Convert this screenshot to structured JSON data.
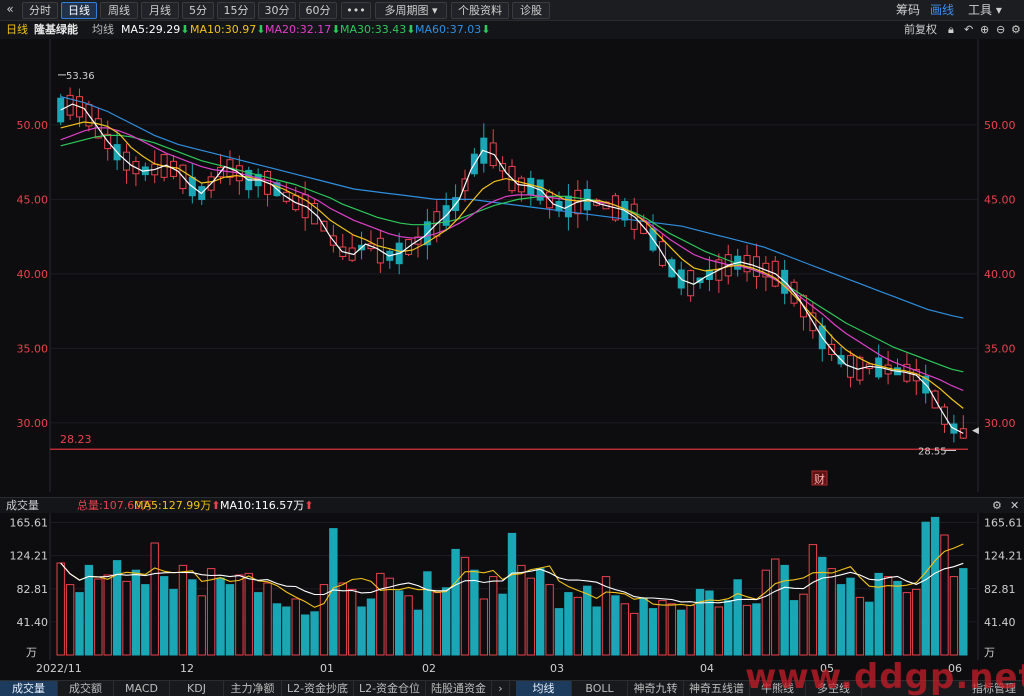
{
  "toolbar": {
    "collapse_icon": "double-chevron-left-icon",
    "left_items": [
      {
        "label": "分时",
        "active": false
      },
      {
        "label": "日线",
        "active": true
      },
      {
        "label": "周线",
        "active": false
      },
      {
        "label": "月线",
        "active": false
      },
      {
        "label": "5分",
        "active": false
      },
      {
        "label": "15分",
        "active": false
      },
      {
        "label": "30分",
        "active": false
      },
      {
        "label": "60分",
        "active": false
      },
      {
        "label": "•••",
        "active": false
      },
      {
        "label": "多周期图 ▾",
        "active": false
      },
      {
        "label": "个股资料",
        "active": false
      },
      {
        "label": "诊股",
        "active": false
      }
    ],
    "right_items": [
      {
        "label": "筹码",
        "active": false
      },
      {
        "label": "画线",
        "active": true
      },
      {
        "label": "工具 ▾",
        "active": false
      }
    ]
  },
  "info": {
    "period": "日线",
    "stock_name": "隆基绿能",
    "avg_label": "均线",
    "ma5": "MA5:29.29",
    "ma10": "MA10:30.97",
    "ma20": "MA20:32.17",
    "ma30": "MA30:33.43",
    "ma60": "MA60:37.03",
    "adjust": "前复权",
    "colors": {
      "ma5": "#ffffff",
      "ma10": "#f2c318",
      "ma20": "#e040c8",
      "ma30": "#2ec95a",
      "ma60": "#2f8fe0",
      "up": "#e8424d",
      "down": "#1aa6b5"
    }
  },
  "volume_header": {
    "title": "成交量",
    "total": "总量:107.60万",
    "ma5": "MA5:127.99万",
    "ma10": "MA10:116.57万"
  },
  "bottom_tabs": [
    {
      "label": "成交量",
      "active": true
    },
    {
      "label": "成交额",
      "active": false
    },
    {
      "label": "MACD",
      "active": false
    },
    {
      "label": "KDJ",
      "active": false
    },
    {
      "label": "主力净额",
      "active": false
    },
    {
      "label": "L2-资金抄底",
      "active": false
    },
    {
      "label": "L2-资金仓位",
      "active": false
    },
    {
      "label": "陆股通资金",
      "active": false
    },
    {
      "label": "›",
      "active": false
    },
    {
      "label": "均线",
      "active": true
    },
    {
      "label": "BOLL",
      "active": false
    },
    {
      "label": "神奇九转",
      "active": false
    },
    {
      "label": "神奇五线谱",
      "active": false
    },
    {
      "label": "牛熊线",
      "active": false
    },
    {
      "label": "多空线",
      "active": false
    },
    {
      "label": "指标管理",
      "active": false
    }
  ],
  "watermark": "www.ddgp.net",
  "chart_data": [
    {
      "type": "candlestick",
      "title": "",
      "y_ticks": [
        "50.00",
        "45.00",
        "40.00",
        "35.00",
        "30.00"
      ],
      "ylim": [
        26.5,
        55.5
      ],
      "annotations": {
        "high_label": "53.36",
        "low_label": "28.55",
        "ref_line_label": "28.23",
        "ref_line_value": 28.23,
        "event_badge": "财"
      },
      "x_tick_labels": [
        "2022/11",
        "12",
        "01",
        "02",
        "03",
        "04",
        "05",
        "06"
      ],
      "ma5": [
        51.0,
        51.4,
        51.1,
        50.0,
        48.9,
        48.0,
        47.3,
        46.9,
        47.0,
        47.3,
        46.9,
        46.0,
        45.4,
        46.2,
        47.2,
        46.9,
        46.3,
        46.3,
        46.0,
        45.3,
        44.8,
        44.5,
        43.8,
        42.5,
        41.5,
        41.3,
        42.0,
        41.7,
        41.2,
        41.4,
        42.0,
        42.5,
        43.3,
        44.0,
        45.0,
        47.0,
        48.3,
        48.0,
        46.8,
        46.0,
        45.9,
        45.6,
        44.7,
        44.4,
        44.8,
        45.0,
        44.7,
        44.5,
        44.3,
        43.8,
        42.9,
        41.8,
        40.5,
        39.6,
        39.3,
        39.8,
        40.2,
        40.6,
        40.8,
        40.6,
        40.3,
        40.0,
        39.3,
        38.3,
        37.0,
        35.7,
        34.7,
        33.9,
        33.6,
        33.8,
        33.7,
        33.5,
        33.4,
        33.2,
        32.4,
        31.0,
        29.7,
        29.29
      ],
      "ma10": [
        49.8,
        50.0,
        50.2,
        50.1,
        49.9,
        49.4,
        48.5,
        47.9,
        47.4,
        47.2,
        47.1,
        46.6,
        46.1,
        46.2,
        46.5,
        46.6,
        46.5,
        46.3,
        46.0,
        45.7,
        45.3,
        44.9,
        44.3,
        43.6,
        43.1,
        42.6,
        42.3,
        41.9,
        41.7,
        41.5,
        41.6,
        42.0,
        42.5,
        43.0,
        43.8,
        44.8,
        45.7,
        46.2,
        46.4,
        46.2,
        46.0,
        45.8,
        45.4,
        45.0,
        44.9,
        44.9,
        44.9,
        44.7,
        44.4,
        44.0,
        43.4,
        42.6,
        41.8,
        41.0,
        40.4,
        40.2,
        40.3,
        40.5,
        40.6,
        40.4,
        40.1,
        39.7,
        39.0,
        38.2,
        37.3,
        36.5,
        35.6,
        34.9,
        34.4,
        34.0,
        33.8,
        33.6,
        33.5,
        33.3,
        32.9,
        32.3,
        31.6,
        30.97
      ],
      "ma20": [
        49.0,
        49.3,
        49.6,
        49.8,
        49.8,
        49.6,
        49.3,
        48.9,
        48.5,
        48.1,
        47.8,
        47.5,
        47.2,
        47.0,
        46.9,
        46.8,
        46.6,
        46.4,
        46.2,
        45.9,
        45.6,
        45.3,
        44.9,
        44.4,
        44.0,
        43.6,
        43.3,
        43.0,
        42.7,
        42.5,
        42.4,
        42.5,
        42.7,
        43.0,
        43.4,
        43.9,
        44.5,
        44.9,
        45.2,
        45.3,
        45.3,
        45.2,
        45.1,
        45.0,
        44.9,
        44.9,
        44.8,
        44.7,
        44.4,
        44.0,
        43.5,
        42.9,
        42.3,
        41.8,
        41.3,
        41.0,
        40.8,
        40.6,
        40.5,
        40.3,
        40.0,
        39.6,
        39.1,
        38.5,
        37.9,
        37.3,
        36.6,
        36.0,
        35.5,
        35.0,
        34.5,
        34.1,
        33.8,
        33.5,
        33.2,
        32.9,
        32.5,
        32.17
      ],
      "ma30": [
        48.6,
        48.8,
        49.0,
        49.2,
        49.3,
        49.3,
        49.2,
        49.0,
        48.8,
        48.5,
        48.2,
        47.9,
        47.6,
        47.4,
        47.2,
        47.0,
        46.8,
        46.6,
        46.4,
        46.2,
        46.0,
        45.7,
        45.4,
        45.1,
        44.7,
        44.4,
        44.1,
        43.8,
        43.6,
        43.4,
        43.3,
        43.3,
        43.4,
        43.5,
        43.7,
        44.0,
        44.3,
        44.6,
        44.8,
        45.0,
        45.1,
        45.2,
        45.2,
        45.2,
        45.1,
        45.0,
        44.9,
        44.7,
        44.4,
        44.1,
        43.7,
        43.2,
        42.7,
        42.3,
        41.9,
        41.5,
        41.2,
        40.9,
        40.6,
        40.3,
        40.0,
        39.6,
        39.2,
        38.7,
        38.2,
        37.7,
        37.2,
        36.7,
        36.3,
        35.9,
        35.5,
        35.1,
        34.8,
        34.5,
        34.2,
        33.9,
        33.6,
        33.43
      ],
      "ma60": [
        51.9,
        51.7,
        51.5,
        51.2,
        50.9,
        50.5,
        50.1,
        49.7,
        49.3,
        49.0,
        48.7,
        48.5,
        48.3,
        48.1,
        47.9,
        47.7,
        47.5,
        47.3,
        47.1,
        46.9,
        46.7,
        46.5,
        46.3,
        46.1,
        45.9,
        45.7,
        45.6,
        45.5,
        45.4,
        45.3,
        45.2,
        45.1,
        45.0,
        45.0,
        45.0,
        45.0,
        44.9,
        44.8,
        44.7,
        44.6,
        44.5,
        44.4,
        44.3,
        44.2,
        44.1,
        44.0,
        43.9,
        43.8,
        43.7,
        43.6,
        43.5,
        43.4,
        43.3,
        43.2,
        43.0,
        42.8,
        42.6,
        42.4,
        42.2,
        42.0,
        41.8,
        41.5,
        41.2,
        40.9,
        40.6,
        40.3,
        40.0,
        39.7,
        39.4,
        39.1,
        38.8,
        38.5,
        38.2,
        37.9,
        37.6,
        37.4,
        37.2,
        37.03
      ]
    },
    {
      "type": "bar",
      "title": "",
      "y_ticks": [
        "165.61",
        "124.21",
        "82.81",
        "41.40"
      ],
      "unit_label": "万",
      "ylim": [
        0,
        170
      ],
      "values": [
        115,
        88,
        78,
        112,
        95,
        100,
        118,
        92,
        106,
        88,
        140,
        98,
        82,
        112,
        94,
        74,
        108,
        96,
        88,
        100,
        102,
        78,
        90,
        64,
        60,
        70,
        50,
        54,
        88,
        158,
        90,
        82,
        60,
        70,
        102,
        96,
        80,
        74,
        56,
        104,
        78,
        84,
        132,
        122,
        106,
        70,
        98,
        76,
        152,
        112,
        96,
        108,
        88,
        58,
        78,
        72,
        86,
        60,
        98,
        74,
        64,
        52,
        70,
        58,
        68,
        64,
        56,
        62,
        82,
        80,
        60,
        68,
        94,
        62,
        64,
        106,
        120,
        112,
        68,
        76,
        138,
        122,
        108,
        88,
        96,
        72,
        66,
        102,
        98,
        92,
        78,
        82,
        166,
        172,
        150,
        98,
        108
      ]
    }
  ]
}
